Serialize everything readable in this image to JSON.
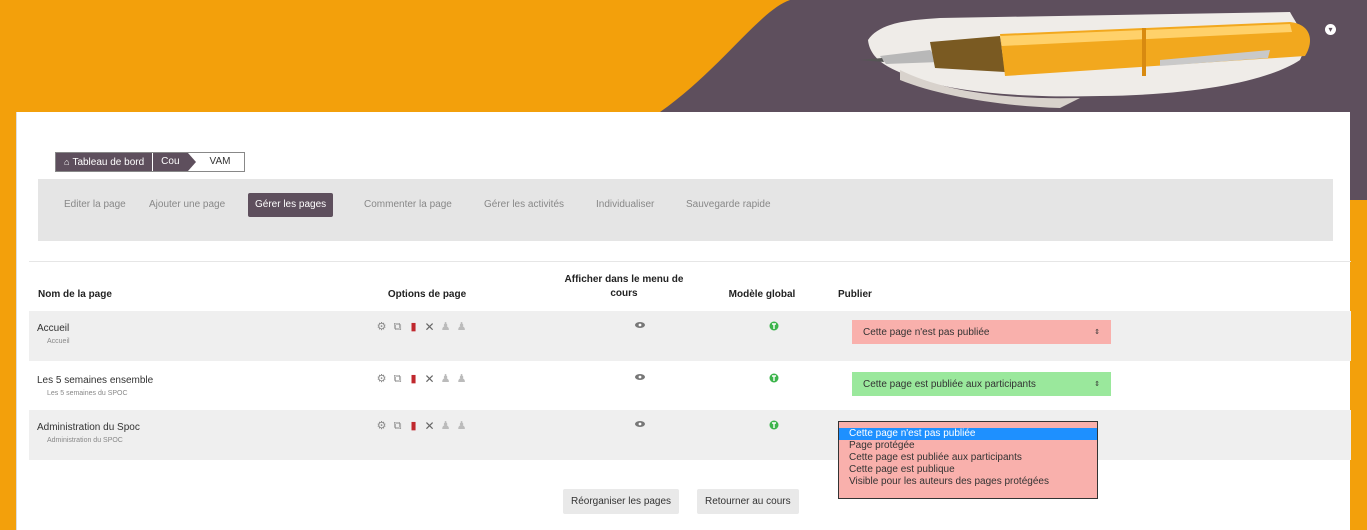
{
  "header": {
    "user_menu_icon": "chevron-down-icon",
    "colors": {
      "orange": "#f3a00b",
      "purple": "#5e4f5d"
    }
  },
  "breadcrumb": {
    "home_icon": "home-icon",
    "items": [
      "Tableau de bord",
      "Cou",
      "VAM"
    ]
  },
  "tabs": [
    "Editer la page",
    "Ajouter une page",
    "Gérer les pages",
    "Commenter la page",
    "Gérer les activités",
    "Individualiser",
    "Sauvegarde rapide"
  ],
  "active_tab": "Gérer les pages",
  "table": {
    "headers": {
      "name": "Nom de la page",
      "options": "Options de page",
      "show_menu": "Afficher dans le menu de cours",
      "model": "Modèle global",
      "publish": "Publier"
    },
    "rows": [
      {
        "name": "Accueil",
        "sub": "Accueil",
        "publish": "Cette page n'est pas publiée",
        "publish_color": "#f9b0ac"
      },
      {
        "name": "Les 5 semaines ensemble",
        "sub": "Les 5 semaines du SPOC",
        "publish": "Cette page est publiée aux participants",
        "publish_color": "#9ae89c"
      },
      {
        "name": "Administration du Spoc",
        "sub": "Administration du SPOC",
        "publish": "Cette page n'est pas publiée",
        "publish_color": "#f9b0ac"
      }
    ]
  },
  "dropdown": {
    "options": [
      "Cette page n'est pas publiée",
      "Page protégée",
      "Cette page est publiée aux participants",
      "Cette page est publique",
      "Visible pour les auteurs des pages protégées"
    ],
    "selected": "Cette page n'est pas publiée"
  },
  "buttons": {
    "reorganize": "Réorganiser les pages",
    "back": "Retourner au cours"
  }
}
